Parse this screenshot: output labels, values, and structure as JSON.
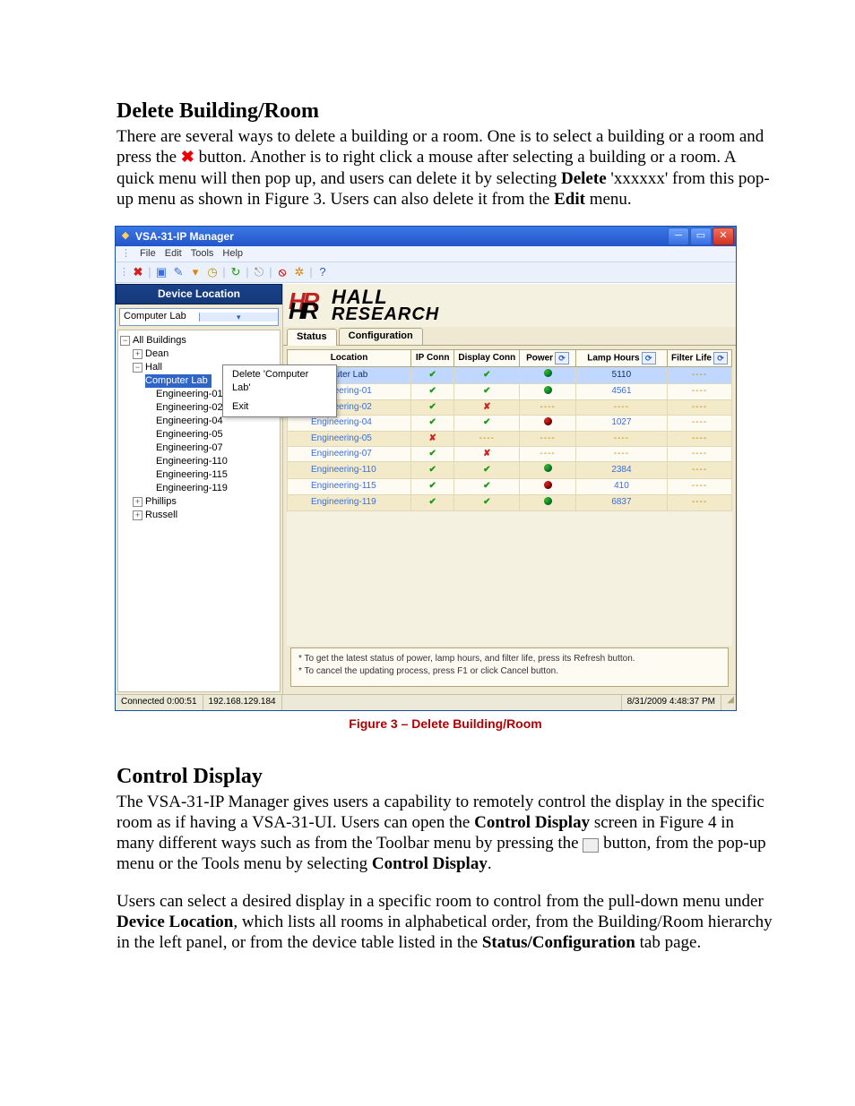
{
  "doc": {
    "h1": "Delete Building/Room",
    "p1a": "There are several ways to delete a building or a room.  One is to select a building or a room and press the ",
    "p1b": " button.  Another is to right click a mouse after selecting a building or a room.  A quick menu will then pop up, and users can delete it by selecting ",
    "p1c": " 'xxxxxx' from this pop-up menu as shown in Figure 3.  Users can also delete it from the ",
    "p1d": " menu.",
    "delete_word": "Delete",
    "edit_word": "Edit",
    "figcap": "Figure 3 – Delete Building/Room",
    "h2": "Control Display",
    "p2a": "The VSA-31-IP Manager gives users a capability to remotely control the display in the specific room as if having a VSA-31-UI.  Users can open the ",
    "p2b": " screen in Figure 4 in many different ways such as from the Toolbar menu by pressing the ",
    "p2c": " button, from the pop-up menu or the Tools menu by selecting ",
    "p2d": ".",
    "ctrl_disp": "Control Display",
    "p3a": "Users can select a desired display in a specific room to control from the pull-down menu under ",
    "p3b": ", which lists all rooms in alphabetical order, from the Building/Room hierarchy in the left panel, or from the device table listed in the ",
    "p3c": " tab page.",
    "dev_loc": "Device Location",
    "stat_conf": "Status/Configuration"
  },
  "win": {
    "title": "VSA-31-IP Manager",
    "menu": [
      "File",
      "Edit",
      "Tools",
      "Help"
    ],
    "loc_header": "Device Location",
    "loc_selected": "Computer Lab",
    "tree": {
      "root": "All Buildings",
      "dean": "Dean",
      "hall": "Hall",
      "hall_children": [
        "Computer Lab",
        "Engineering-01",
        "Engineering-02",
        "Engineering-04",
        "Engineering-05",
        "Engineering-07",
        "Engineering-110",
        "Engineering-115",
        "Engineering-119"
      ],
      "phillips": "Phillips",
      "russell": "Russell"
    },
    "ctx": {
      "del": "Delete 'Computer Lab'",
      "exit": "Exit"
    },
    "logo": {
      "l1": "HALL",
      "l2": "RESEARCH"
    },
    "tabs": {
      "status": "Status",
      "config": "Configuration"
    },
    "cols": {
      "loc": "Location",
      "ip": "IP Conn",
      "disp": "Display Conn",
      "power": "Power",
      "lamp": "Lamp Hours",
      "filter": "Filter Life"
    },
    "rows": [
      {
        "loc": "Computer Lab",
        "ip": "ok",
        "disp": "ok",
        "power": "g",
        "lamp": "5110",
        "filter": "----",
        "sel": true
      },
      {
        "loc": "Engineering-01",
        "ip": "ok",
        "disp": "ok",
        "power": "g",
        "lamp": "4561",
        "filter": "----"
      },
      {
        "loc": "Engineering-02",
        "ip": "ok",
        "disp": "bad",
        "power": "----",
        "lamp": "----",
        "filter": "----",
        "alt": true
      },
      {
        "loc": "Engineering-04",
        "ip": "ok",
        "disp": "ok",
        "power": "r",
        "lamp": "1027",
        "filter": "----"
      },
      {
        "loc": "Engineering-05",
        "ip": "bad",
        "disp": "----",
        "power": "----",
        "lamp": "----",
        "filter": "----",
        "alt": true
      },
      {
        "loc": "Engineering-07",
        "ip": "ok",
        "disp": "bad",
        "power": "----",
        "lamp": "----",
        "filter": "----"
      },
      {
        "loc": "Engineering-110",
        "ip": "ok",
        "disp": "ok",
        "power": "g",
        "lamp": "2384",
        "filter": "----",
        "alt": true
      },
      {
        "loc": "Engineering-115",
        "ip": "ok",
        "disp": "ok",
        "power": "r",
        "lamp": "410",
        "filter": "----"
      },
      {
        "loc": "Engineering-119",
        "ip": "ok",
        "disp": "ok",
        "power": "g",
        "lamp": "6837",
        "filter": "----",
        "alt": true
      }
    ],
    "hint1": "* To get the latest status of power, lamp hours, and filter life, press its Refresh button.",
    "hint2": "* To cancel the updating process, press F1 or click Cancel button.",
    "status": {
      "conn": "Connected  0:00:51",
      "ip": "192.168.129.184",
      "time": "8/31/2009 4:48:37 PM"
    }
  }
}
